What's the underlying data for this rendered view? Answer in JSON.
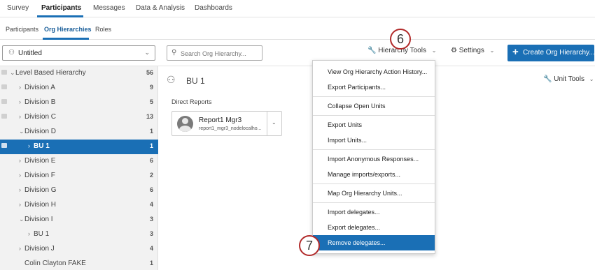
{
  "top_tabs": [
    "Survey",
    "Participants",
    "Messages",
    "Data & Analysis",
    "Dashboards"
  ],
  "sub_tabs": [
    "Participants",
    "Org Hierarchies",
    "Roles"
  ],
  "toolbar": {
    "hierarchy_select_value": "Untitled",
    "search_placeholder": "Search Org Hierarchy...",
    "hierarchy_tools_label": "Hierarchy Tools",
    "settings_label": "Settings",
    "create_button_label": "Create Org Hierarchy..."
  },
  "tree": [
    {
      "name": "Level Based Hierarchy",
      "count": "56",
      "chevron": "⌄",
      "selected": false
    },
    {
      "name": "Division A",
      "count": "9",
      "chevron": "›",
      "selected": false
    },
    {
      "name": "Division B",
      "count": "5",
      "chevron": "›",
      "selected": false
    },
    {
      "name": "Division C",
      "count": "13",
      "chevron": "›",
      "selected": false
    },
    {
      "name": "Division D",
      "count": "1",
      "chevron": "⌄",
      "selected": false
    },
    {
      "name": "BU 1",
      "count": "1",
      "chevron": "›",
      "selected": true
    },
    {
      "name": "Division E",
      "count": "6",
      "chevron": "›",
      "selected": false
    },
    {
      "name": "Division F",
      "count": "2",
      "chevron": "›",
      "selected": false
    },
    {
      "name": "Division G",
      "count": "6",
      "chevron": "›",
      "selected": false
    },
    {
      "name": "Division H",
      "count": "4",
      "chevron": "›",
      "selected": false
    },
    {
      "name": "Division I",
      "count": "3",
      "chevron": "⌄",
      "selected": false
    },
    {
      "name": "BU 1",
      "count": "3",
      "chevron": "›",
      "selected": false
    },
    {
      "name": "Division J",
      "count": "4",
      "chevron": "›",
      "selected": false
    },
    {
      "name": "Colin Clayton FAKE",
      "count": "1",
      "chevron": "",
      "selected": false
    }
  ],
  "main": {
    "unit_title": "BU 1",
    "unit_tools_label": "Unit Tools",
    "direct_reports_label": "Direct Reports",
    "report": {
      "name": "Report1 Mgr3",
      "email": "report1_mgr3_nodelocalho..."
    }
  },
  "menu": {
    "groups": [
      [
        "View Org Hierarchy Action History...",
        "Export Participants..."
      ],
      [
        "Collapse Open Units"
      ],
      [
        "Export Units",
        "Import Units..."
      ],
      [
        "Import Anonymous Responses...",
        "Manage imports/exports..."
      ],
      [
        "Map Org Hierarchy Units..."
      ],
      [
        "Import delegates...",
        "Export delegates...",
        "Remove delegates..."
      ]
    ],
    "active_item": "Remove delegates..."
  },
  "steps": [
    "6",
    "7"
  ],
  "colors": {
    "accent": "#1a6fb5",
    "step_badge_border": "#b12a2a",
    "tree_background": "#f2f2f2"
  }
}
